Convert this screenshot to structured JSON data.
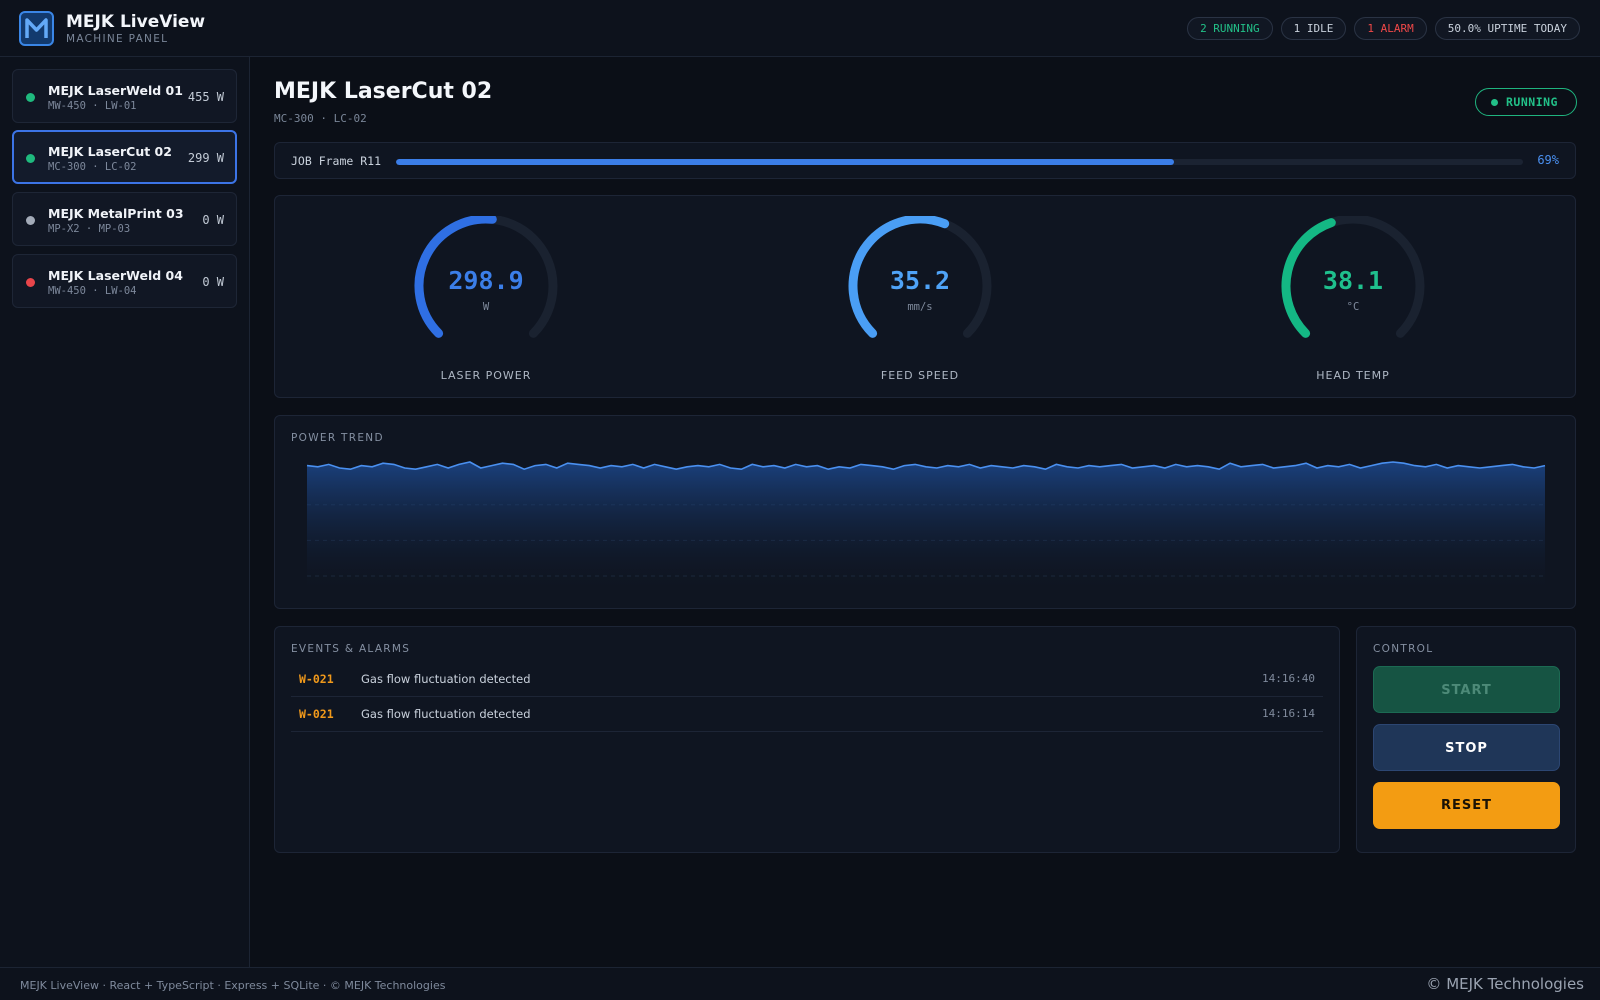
{
  "app": {
    "title": "MEJK LiveView",
    "subtitle": "MACHINE PANEL"
  },
  "summary": {
    "running": "2 RUNNING",
    "idle": "1 IDLE",
    "alarm": "1 ALARM",
    "uptime": "50.0% UPTIME TODAY"
  },
  "machines": [
    {
      "name": "MEJK LaserWeld 01",
      "model": "MW-450 · LW-01",
      "power": "455 W",
      "status": "running",
      "color": "#1fba7e"
    },
    {
      "name": "MEJK LaserCut 02",
      "model": "MC-300 · LC-02",
      "power": "299 W",
      "status": "running",
      "color": "#1fba7e"
    },
    {
      "name": "MEJK MetalPrint 03",
      "model": "MP-X2 · MP-03",
      "power": "0 W",
      "status": "idle",
      "color": "#a3abb8"
    },
    {
      "name": "MEJK LaserWeld 04",
      "model": "MW-450 · LW-04",
      "power": "0 W",
      "status": "alarm",
      "color": "#e8454a"
    }
  ],
  "selected": {
    "name": "MEJK LaserCut 02",
    "model": "MC-300 · LC-02",
    "status": "RUNNING"
  },
  "job": {
    "label": "JOB Frame R11",
    "progress": 0.69,
    "progress_text": "69%"
  },
  "gauges": [
    {
      "label": "LASER POWER",
      "value": "298.9",
      "unit": "W",
      "fraction": 0.52,
      "color": "#2f6fe3",
      "value_color": "#3b7ee8"
    },
    {
      "label": "FEED SPEED",
      "value": "35.2",
      "unit": "mm/s",
      "fraction": 0.58,
      "color": "#4a9ef5",
      "value_color": "#4fa3f7"
    },
    {
      "label": "HEAD TEMP",
      "value": "38.1",
      "unit": "°C",
      "fraction": 0.43,
      "color": "#14b884",
      "value_color": "#1fc08d"
    }
  ],
  "trend": {
    "title": "POWER TREND",
    "line_color": "#4a90f0",
    "values": [
      302,
      301,
      303,
      300,
      299,
      302,
      301,
      304,
      303,
      300,
      299,
      301,
      303,
      300,
      303,
      305,
      300,
      302,
      304,
      303,
      299,
      302,
      303,
      300,
      304,
      303,
      302,
      300,
      302,
      301,
      303,
      300,
      303,
      301,
      299,
      301,
      302,
      301,
      303,
      300,
      299,
      303,
      301,
      302,
      300,
      303,
      301,
      302,
      299,
      301,
      300,
      303,
      302,
      301,
      299,
      302,
      303,
      301,
      300,
      302,
      301,
      303,
      300,
      302,
      301,
      300,
      302,
      301,
      299,
      303,
      301,
      300,
      302,
      301,
      302,
      303,
      300,
      301,
      302,
      300,
      303,
      301,
      302,
      301,
      299,
      304,
      301,
      302,
      303,
      300,
      301,
      302,
      304,
      300,
      302,
      301,
      303,
      300,
      302,
      304,
      305,
      304,
      302,
      301,
      303,
      300,
      302,
      301,
      300,
      301,
      302,
      303,
      301,
      300,
      302
    ]
  },
  "events": {
    "title": "EVENTS & ALARMS",
    "rows": [
      {
        "code": "W-021",
        "message": "Gas flow fluctuation detected",
        "time": "14:16:40"
      },
      {
        "code": "W-021",
        "message": "Gas flow fluctuation detected",
        "time": "14:16:14"
      }
    ]
  },
  "control": {
    "title": "CONTROL",
    "start": "START",
    "stop": "STOP",
    "reset": "RESET"
  },
  "footer": {
    "left": "MEJK LiveView · React + TypeScript · Express + SQLite · © MEJK Technologies",
    "right": "© MEJK Technologies"
  }
}
